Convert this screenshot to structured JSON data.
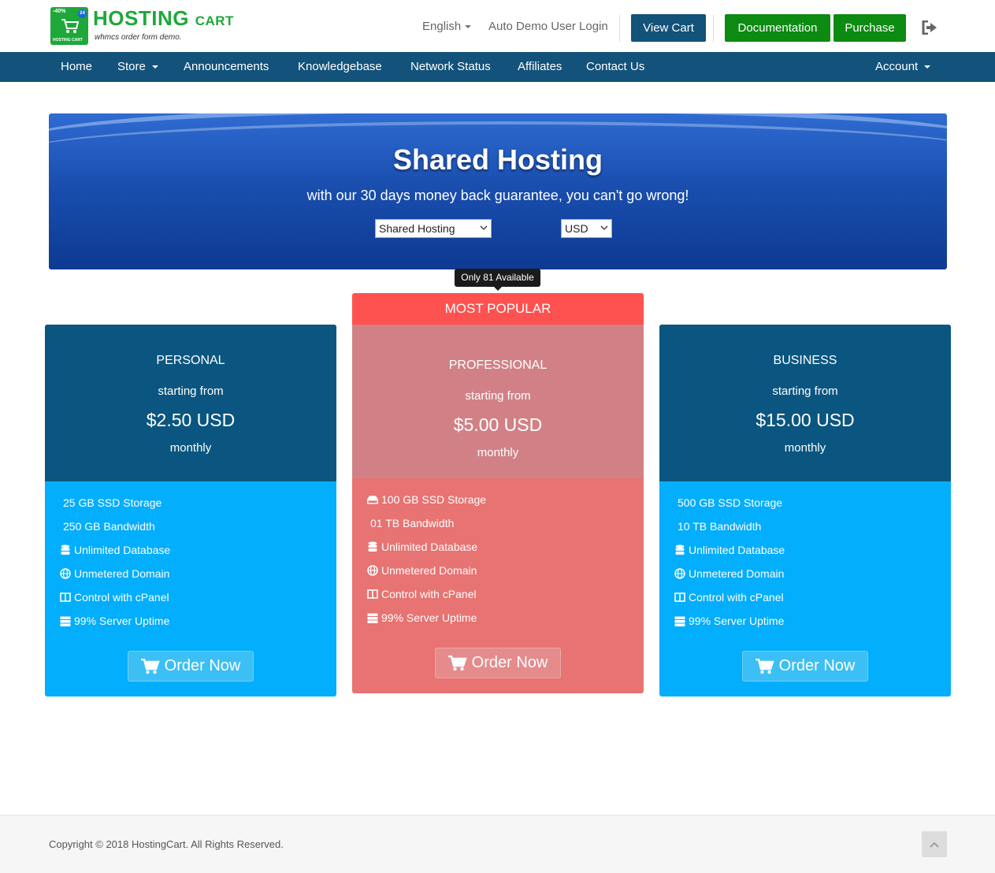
{
  "brand": {
    "title": "HOSTING",
    "title_suffix": "CART",
    "tagline": "whmcs order form demo.",
    "badge_discount": "-40%",
    "badge_24": "24",
    "box_label": "HOSTING CART",
    "color": "#1ea83a"
  },
  "header": {
    "language": "English",
    "login": "Auto Demo User Login",
    "view_cart": "View Cart",
    "documentation": "Documentation",
    "purchase": "Purchase",
    "logout_icon": "sign-out-icon"
  },
  "nav": {
    "items": [
      "Home",
      "Store",
      "Announcements",
      "Knowledgebase",
      "Network Status",
      "Affiliates",
      "Contact Us"
    ],
    "account": "Account",
    "color": "#13527a"
  },
  "banner": {
    "title": "Shared Hosting",
    "subtitle": "with our 30 days money back guarantee, you can't go wrong!",
    "category_select": "Shared Hosting",
    "currency_select": "USD"
  },
  "tooltip": "Only 81 Available",
  "most_popular": "MOST POPULAR",
  "plans": [
    {
      "name": "PERSONAL",
      "starting_from": "starting from",
      "price": "$2.50 USD",
      "cycle": "monthly",
      "features": [
        "25 GB SSD Storage",
        "250 GB Bandwidth",
        "Unlimited Database",
        "Unmetered Domain",
        "Control with cPanel",
        "99% Server Uptime"
      ],
      "order": "Order Now",
      "head_color": "#0b5680",
      "body_color": "#03aefd"
    },
    {
      "name": "PROFESSIONAL",
      "starting_from": "starting from",
      "price": "$5.00 USD",
      "cycle": "monthly",
      "features": [
        "100 GB SSD Storage",
        "01 TB Bandwidth",
        "Unlimited Database",
        "Unmetered Domain",
        "Control with cPanel",
        "99% Server Uptime"
      ],
      "order": "Order Now",
      "head_color": "#d18186",
      "body_color": "#e77372"
    },
    {
      "name": "BUSINESS",
      "starting_from": "starting from",
      "price": "$15.00 USD",
      "cycle": "monthly",
      "features": [
        "500 GB SSD Storage",
        "10 TB Bandwidth",
        "Unlimited Database",
        "Unmetered Domain",
        "Control with cPanel",
        "99% Server Uptime"
      ],
      "order": "Order Now",
      "head_color": "#0b5680",
      "body_color": "#03aefd"
    }
  ],
  "footer": {
    "copyright": "Copyright © 2018 HostingCart. All Rights Reserved."
  }
}
